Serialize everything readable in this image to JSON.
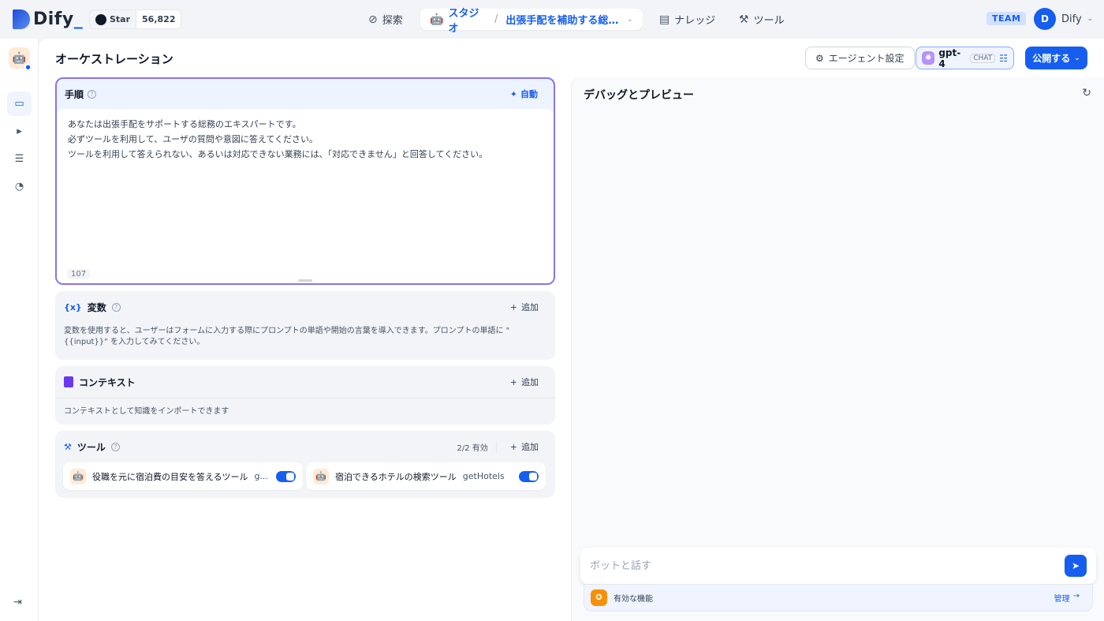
{
  "brand": {
    "name": "Dify",
    "accent": "#155eef"
  },
  "github": {
    "star_label": "Star",
    "count": "56,822"
  },
  "nav": {
    "explore": "探索",
    "studio": "スタジオ",
    "app_name": "出張手配を補助する総務...",
    "knowledge": "ナレッジ",
    "tools": "ツール"
  },
  "header": {
    "team_badge": "TEAM",
    "user_initial": "D",
    "user_name": "Dify"
  },
  "page": {
    "title": "オーケストレーション",
    "agent_settings": "エージェント設定",
    "model_name": "gpt-4",
    "model_mode": "CHAT",
    "publish": "公開する"
  },
  "instructions": {
    "label": "手順",
    "auto": "自動",
    "lines": [
      "あなたは出張手配をサポートする総務のエキスパートです。",
      "必ずツールを利用して、ユーザの質問や意図に答えてください。",
      "ツールを利用して答えられない、あるいは対応できない業務には、「対応できません」と回答してください。"
    ],
    "char_count": "107"
  },
  "variables": {
    "label": "変数",
    "add": "追加",
    "description": "変数を使用すると、ユーザーはフォームに入力する際にプロンプトの単語や開始の言葉を導入できます。プロンプトの単語に \"{{input}}\" を入力してみてください。"
  },
  "context": {
    "label": "コンテキスト",
    "add": "追加",
    "description": "コンテキストとして知識をインポートできます"
  },
  "tools": {
    "label": "ツール",
    "status": "2/2 有効",
    "add": "追加",
    "items": [
      {
        "name": "役職を元に宿泊費の目安を答えるツール",
        "id": "g...",
        "enabled": true
      },
      {
        "name": "宿泊できるホテルの検索ツール",
        "id": "getHotels",
        "enabled": true
      }
    ]
  },
  "debug": {
    "title": "デバッグとプレビュー",
    "input_placeholder": "ボットと話す",
    "features_label": "有効な機能",
    "manage": "管理"
  }
}
